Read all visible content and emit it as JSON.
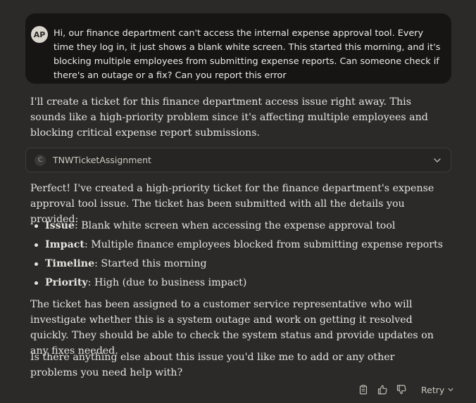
{
  "user_message": {
    "avatar_initials": "AP",
    "text": "Hi, our finance department can't access the internal expense approval tool. Every time they log in, it just shows a blank white screen. This started this morning, and it's blocking multiple employees from submitting expense reports. Can someone check if there's an outage or a fix? Can you report this error"
  },
  "assistant": {
    "intro": "I'll create a ticket for this finance department access issue right away. This sounds like a high-priority problem since it's affecting multiple employees and blocking critical expense report submissions.",
    "tool": {
      "badge": "C",
      "name": "TNWTicketAssignment",
      "icon": "chevron-down-icon"
    },
    "confirmation": "Perfect! I've created a high-priority ticket for the finance department's expense approval tool issue. The ticket has been submitted with all the details you provided:",
    "details": [
      {
        "label": "Issue",
        "value": ": Blank white screen when accessing the expense approval tool"
      },
      {
        "label": "Impact",
        "value": ": Multiple finance employees blocked from submitting expense reports"
      },
      {
        "label": "Timeline",
        "value": ": Started this morning"
      },
      {
        "label": "Priority",
        "value": ": High (due to business impact)"
      }
    ],
    "assignment": "The ticket has been assigned to a customer service representative who will investigate whether this is a system outage and work on getting it resolved quickly. They should be able to check the system status and provide updates on any fixes needed.",
    "followup": "Is there anything else about this issue you'd like me to add or any other problems you need help with?"
  },
  "actions": {
    "copy_icon": "clipboard-icon",
    "like_icon": "thumbs-up-icon",
    "dislike_icon": "thumbs-down-icon",
    "retry_label": "Retry"
  }
}
